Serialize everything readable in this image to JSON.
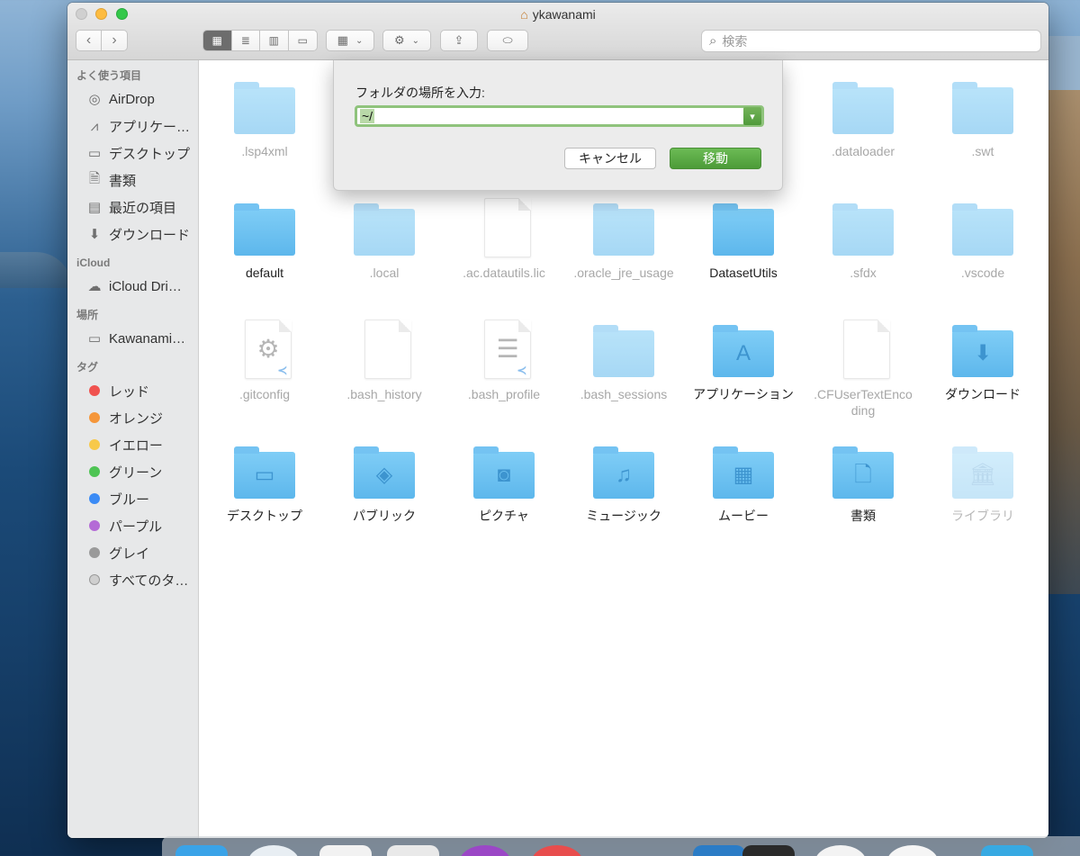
{
  "window": {
    "title": "ykawanami"
  },
  "toolbar": {
    "back": "‹",
    "forward": "›",
    "search_placeholder": "検索"
  },
  "sidebar": {
    "favorites_head": "よく使う項目",
    "favorites": [
      {
        "label": "AirDrop",
        "icon": "airdrop-icon",
        "glyph": "◎"
      },
      {
        "label": "アプリケー…",
        "icon": "applications-icon",
        "glyph": "⩘"
      },
      {
        "label": "デスクトップ",
        "icon": "desktop-icon",
        "glyph": "▭"
      },
      {
        "label": "書類",
        "icon": "documents-icon",
        "glyph": "🗎"
      },
      {
        "label": "最近の項目",
        "icon": "recents-icon",
        "glyph": "▤"
      },
      {
        "label": "ダウンロード",
        "icon": "downloads-icon",
        "glyph": "⬇"
      }
    ],
    "icloud_head": "iCloud",
    "icloud": [
      {
        "label": "iCloud Dri…",
        "icon": "cloud-icon",
        "glyph": "☁"
      }
    ],
    "locations_head": "場所",
    "locations": [
      {
        "label": "Kawanami…",
        "icon": "laptop-icon",
        "glyph": "▭"
      }
    ],
    "tags_head": "タグ",
    "tags": [
      {
        "label": "レッド",
        "color": "#f0524f"
      },
      {
        "label": "オレンジ",
        "color": "#f5963a"
      },
      {
        "label": "イエロー",
        "color": "#f7c94a"
      },
      {
        "label": "グリーン",
        "color": "#4ec454"
      },
      {
        "label": "ブルー",
        "color": "#3b8bf5"
      },
      {
        "label": "パープル",
        "color": "#b46bd6"
      },
      {
        "label": "グレイ",
        "color": "#9a9a9a"
      },
      {
        "label": "すべてのタ…",
        "color": "#cfcfcf"
      }
    ]
  },
  "files": [
    {
      "name": ".lsp4xml",
      "kind": "folder",
      "hidden": true,
      "glyph": ""
    },
    {
      "name": ".dataloader",
      "kind": "folder",
      "hidden": true,
      "glyph": ""
    },
    {
      "name": ".swt",
      "kind": "folder",
      "hidden": true,
      "glyph": ""
    },
    {
      "name": "default",
      "kind": "folder",
      "hidden": false,
      "glyph": ""
    },
    {
      "name": ".local",
      "kind": "folder",
      "hidden": true,
      "glyph": ""
    },
    {
      "name": ".ac.datautils.lic",
      "kind": "doc",
      "hidden": true,
      "glyph": ""
    },
    {
      "name": ".oracle_jre_usage",
      "kind": "folder",
      "hidden": true,
      "glyph": ""
    },
    {
      "name": "DatasetUtils",
      "kind": "folder",
      "hidden": false,
      "glyph": ""
    },
    {
      "name": ".sfdx",
      "kind": "folder",
      "hidden": true,
      "glyph": ""
    },
    {
      "name": ".vscode",
      "kind": "folder",
      "hidden": true,
      "glyph": ""
    },
    {
      "name": ".gitconfig",
      "kind": "doc-gear",
      "hidden": true,
      "glyph": "⚙"
    },
    {
      "name": ".bash_history",
      "kind": "doc",
      "hidden": true,
      "glyph": ""
    },
    {
      "name": ".bash_profile",
      "kind": "doc-text",
      "hidden": true,
      "glyph": "☰"
    },
    {
      "name": ".bash_sessions",
      "kind": "folder",
      "hidden": true,
      "glyph": ""
    },
    {
      "name": "アプリケーション",
      "kind": "folder",
      "hidden": false,
      "glyph": "A"
    },
    {
      "name": ".CFUserTextEncoding",
      "kind": "doc",
      "hidden": true,
      "glyph": ""
    },
    {
      "name": "ダウンロード",
      "kind": "folder",
      "hidden": false,
      "glyph": "⬇"
    },
    {
      "name": "デスクトップ",
      "kind": "folder",
      "hidden": false,
      "glyph": "▭"
    },
    {
      "name": "パブリック",
      "kind": "folder",
      "hidden": false,
      "glyph": "◈"
    },
    {
      "name": "ピクチャ",
      "kind": "folder",
      "hidden": false,
      "glyph": "◙"
    },
    {
      "name": "ミュージック",
      "kind": "folder",
      "hidden": false,
      "glyph": "♫"
    },
    {
      "name": "ムービー",
      "kind": "folder",
      "hidden": false,
      "glyph": "▦"
    },
    {
      "name": "書類",
      "kind": "folder",
      "hidden": false,
      "glyph": "🗋"
    },
    {
      "name": "ライブラリ",
      "kind": "folder",
      "hidden": false,
      "dim": true,
      "glyph": "🏛"
    }
  ],
  "goto_sheet": {
    "label": "フォルダの場所を入力:",
    "value": "~/",
    "cancel": "キャンセル",
    "go": "移動"
  },
  "colors": {
    "folder_blue": "#5db7ec",
    "go_green": "#4c9b38",
    "input_focus": "#8fc37c"
  }
}
